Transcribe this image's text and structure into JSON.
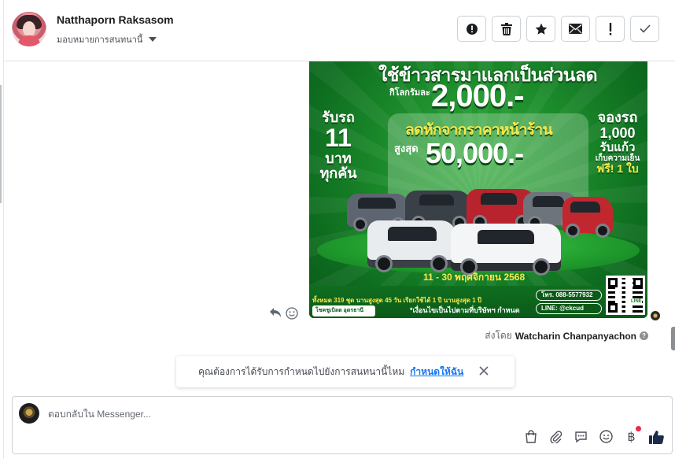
{
  "header": {
    "contact_name": "Natthaporn Raksasom",
    "assign_label": "มอบหมายการสนทนานี้",
    "toolbar": [
      {
        "name": "spam-button",
        "icon": "alert-circle-icon"
      },
      {
        "name": "delete-button",
        "icon": "trash-icon"
      },
      {
        "name": "star-button",
        "icon": "star-icon"
      },
      {
        "name": "mark-unread-button",
        "icon": "envelope-icon"
      },
      {
        "name": "flag-button",
        "icon": "exclamation-icon"
      },
      {
        "name": "mark-done-button",
        "icon": "check-icon"
      }
    ]
  },
  "ad": {
    "headline": "ใช้ข้าวสารมาแลกเป็นส่วนลด",
    "per_kg": "กิโลกรัมละ",
    "per_kg_amount": "2,000.-",
    "discount_label": "ลดหักจากราคาหน้าร้าน",
    "max_label": "สูงสุด",
    "max_amount": "50,000.-",
    "left": {
      "a": "รับรถ",
      "b": "11",
      "c": "บาท",
      "d": "ทุกคัน"
    },
    "right": {
      "a": "จองรถ",
      "b": "1,000",
      "c": "รับแก้ว",
      "d": "เก็บความเย็น",
      "e": "ฟรี! 1 ใบ"
    },
    "date_range": "11 - 30 พฤศจิกายน 2568",
    "phone": "โทร. 088-5577932",
    "line": "LINE: @ckcud",
    "qr_label": "LINE",
    "footer_note": "ทั้งหมด 319 ชุด  นานสูงสุด 45 วัน  เรียกใช้ได้ 1 ปี  นานสูงสุด 1 ปี",
    "condition": "*เงื่อนไขเป็นไปตามที่บริษัทฯ กำหนด",
    "dealer": "โชคชูเบิลด อุดรธานี"
  },
  "message": {
    "sent_by_prefix": "ส่งโดย",
    "sent_by_name": "Watcharin Chanpanyachon"
  },
  "banner": {
    "text": "คุณต้องการได้รับการกำหนดไปยังการสนทนานี้ไหม",
    "link": "กำหนดให้ฉัน"
  },
  "composer": {
    "placeholder": "ตอบกลับใน Messenger...",
    "tools": [
      "shopping-bag-icon",
      "paperclip-icon",
      "saved-reply-icon",
      "emoji-icon",
      "baht-icon",
      "thumbs-up-icon"
    ],
    "baht_symbol": "฿"
  },
  "colors": {
    "link": "#1877f2",
    "ad_green": "#1b8a2a",
    "ad_yellow": "#f7e84a",
    "notification_dot": "#f02849"
  }
}
